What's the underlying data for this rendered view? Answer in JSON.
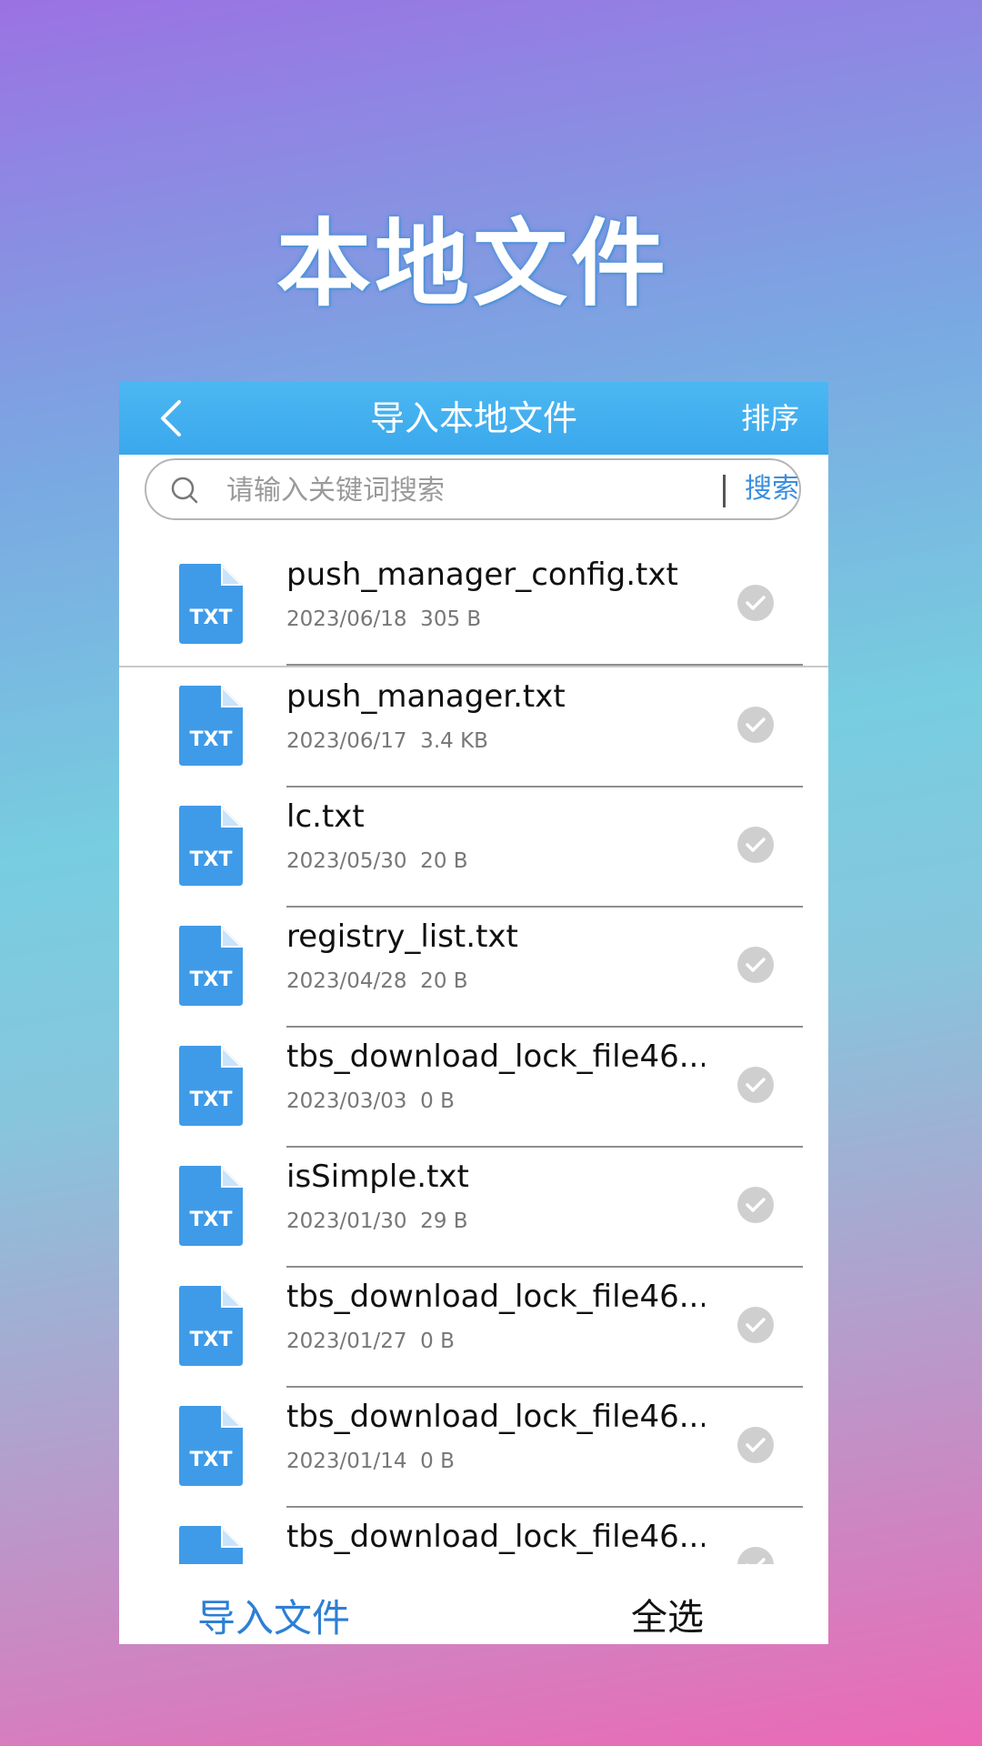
{
  "hero": {
    "title": "本地文件"
  },
  "topbar": {
    "title": "导入本地文件",
    "sort_label": "排序"
  },
  "search": {
    "placeholder": "请输入关键词搜索",
    "button_label": "搜索"
  },
  "files": [
    {
      "name": "push_manager_config.txt",
      "meta": "2023/06/18  305 B",
      "icon": "TXT"
    },
    {
      "name": "push_manager.txt",
      "meta": "2023/06/17  3.4 KB",
      "icon": "TXT"
    },
    {
      "name": "lc.txt",
      "meta": "2023/05/30  20 B",
      "icon": "TXT"
    },
    {
      "name": "registry_list.txt",
      "meta": "2023/04/28  20 B",
      "icon": "TXT"
    },
    {
      "name": "tbs_download_lock_file46...",
      "meta": "2023/03/03  0 B",
      "icon": "TXT"
    },
    {
      "name": "isSimple.txt",
      "meta": "2023/01/30  29 B",
      "icon": "TXT"
    },
    {
      "name": "tbs_download_lock_file46...",
      "meta": "2023/01/27  0 B",
      "icon": "TXT"
    },
    {
      "name": "tbs_download_lock_file46...",
      "meta": "2023/01/14  0 B",
      "icon": "TXT"
    },
    {
      "name": "tbs_download_lock_file46...",
      "meta": "",
      "icon": "TXT"
    }
  ],
  "bottom": {
    "import_label": "导入文件",
    "select_all_label": "全选"
  },
  "colors": {
    "topbar": "#3aa8ec",
    "file_icon": "#3f9be8",
    "check": "#cfcfcf",
    "accent": "#2e7fd4"
  }
}
